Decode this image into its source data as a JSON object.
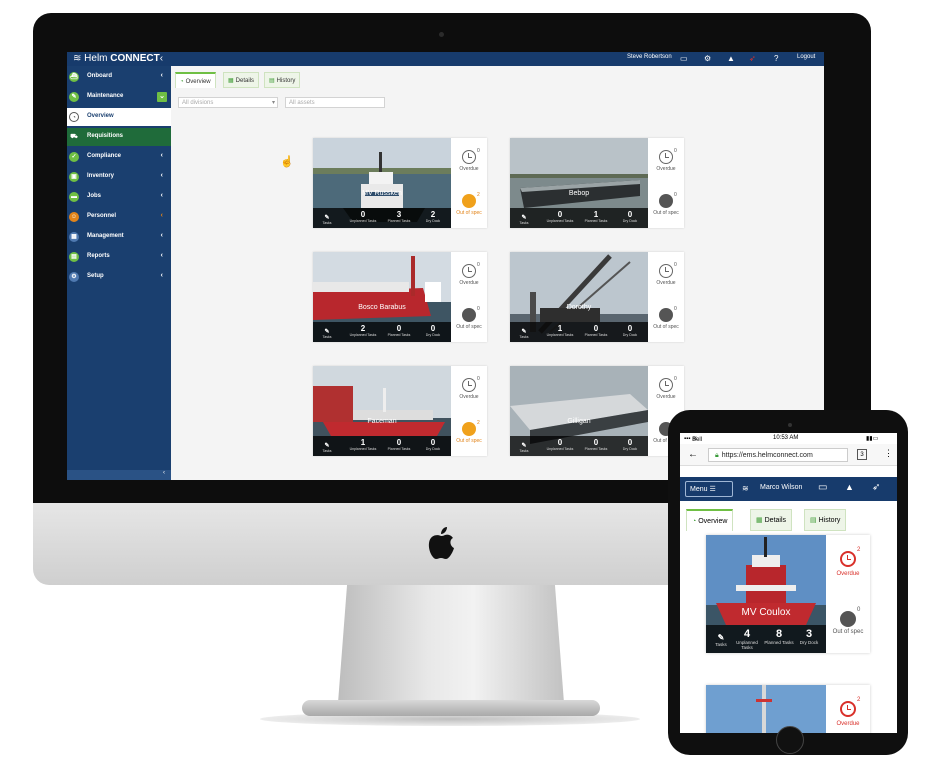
{
  "desktop": {
    "brand_prefix": "Helm",
    "brand_suffix": "CONNECT",
    "brand_chevron": "‹",
    "user": "Steve Robertson",
    "logout": "Logout",
    "sidebar": {
      "items": [
        {
          "label": "Onboard",
          "icon": "ship-icon",
          "chev": "‹"
        },
        {
          "label": "Maintenance",
          "icon": "wrench-icon",
          "chev": "⌄"
        },
        {
          "label": "Overview",
          "icon": "dashboard-icon",
          "chev": ""
        },
        {
          "label": "Requisitions",
          "icon": "cart-icon",
          "chev": ""
        },
        {
          "label": "Compliance",
          "icon": "shield-icon",
          "chev": "‹"
        },
        {
          "label": "Inventory",
          "icon": "box-icon",
          "chev": "‹"
        },
        {
          "label": "Jobs",
          "icon": "briefcase-icon",
          "chev": "‹"
        },
        {
          "label": "Personnel",
          "icon": "people-icon",
          "chev": "‹"
        },
        {
          "label": "Management",
          "icon": "grid-icon",
          "chev": "‹"
        },
        {
          "label": "Reports",
          "icon": "chart-icon",
          "chev": "‹"
        },
        {
          "label": "Setup",
          "icon": "gear-icon",
          "chev": "‹"
        }
      ],
      "footer": "‹"
    },
    "tabs": [
      "Overview",
      "Details",
      "History"
    ],
    "filters": {
      "divisions": "All divisions",
      "assets": "All assets"
    },
    "stat_captions": [
      "Unplanned Tasks",
      "Planned Tasks",
      "Dry Dock"
    ],
    "tasks_caption": "Tasks",
    "overdue_label": "Overdue",
    "oos_label": "Out of spec",
    "vessels": [
      {
        "name": "MV Russken",
        "unplanned": "0",
        "planned": "3",
        "drydock": "2",
        "overdue": "0",
        "oos": "2",
        "photo": "tug"
      },
      {
        "name": "Bebop",
        "unplanned": "0",
        "planned": "1",
        "drydock": "0",
        "overdue": "0",
        "oos": "0",
        "photo": "barge"
      },
      {
        "name": "Bosco Barabus",
        "unplanned": "2",
        "planned": "0",
        "drydock": "0",
        "overdue": "0",
        "oos": "0",
        "photo": "ship"
      },
      {
        "name": "Dorothy",
        "unplanned": "1",
        "planned": "0",
        "drydock": "0",
        "overdue": "0",
        "oos": "0",
        "photo": "crane"
      },
      {
        "name": "Faceman",
        "unplanned": "1",
        "planned": "0",
        "drydock": "0",
        "overdue": "0",
        "oos": "2",
        "photo": "ship2"
      },
      {
        "name": "Gilligan",
        "unplanned": "0",
        "planned": "0",
        "drydock": "0",
        "overdue": "0",
        "oos": "0",
        "photo": "barge2"
      }
    ]
  },
  "tablet": {
    "status_left": "Bell",
    "time": "10:53 AM",
    "url": "https://ems.helmconnect.com",
    "tab_count": "3",
    "menu_label": "Menu",
    "user": "Marco Wilson",
    "tabs": [
      "Overview",
      "Details",
      "History"
    ],
    "stat_captions": [
      "Unplanned Tasks",
      "Planned Tasks",
      "Dry Dock"
    ],
    "tasks_caption": "Tasks",
    "overdue_label": "Overdue",
    "oos_label": "Out of spec",
    "cards": [
      {
        "name": "MV Coulox",
        "unplanned": "4",
        "planned": "8",
        "drydock": "3",
        "overdue": "2",
        "oos": "0"
      },
      {
        "name": "",
        "overdue": "2"
      }
    ]
  },
  "colors": {
    "nav": "#173b6c",
    "sidebar": "#1a3f6f",
    "accent_green": "#6fbf44",
    "warn_orange": "#f0a11b",
    "overdue_red": "#d9302a"
  }
}
